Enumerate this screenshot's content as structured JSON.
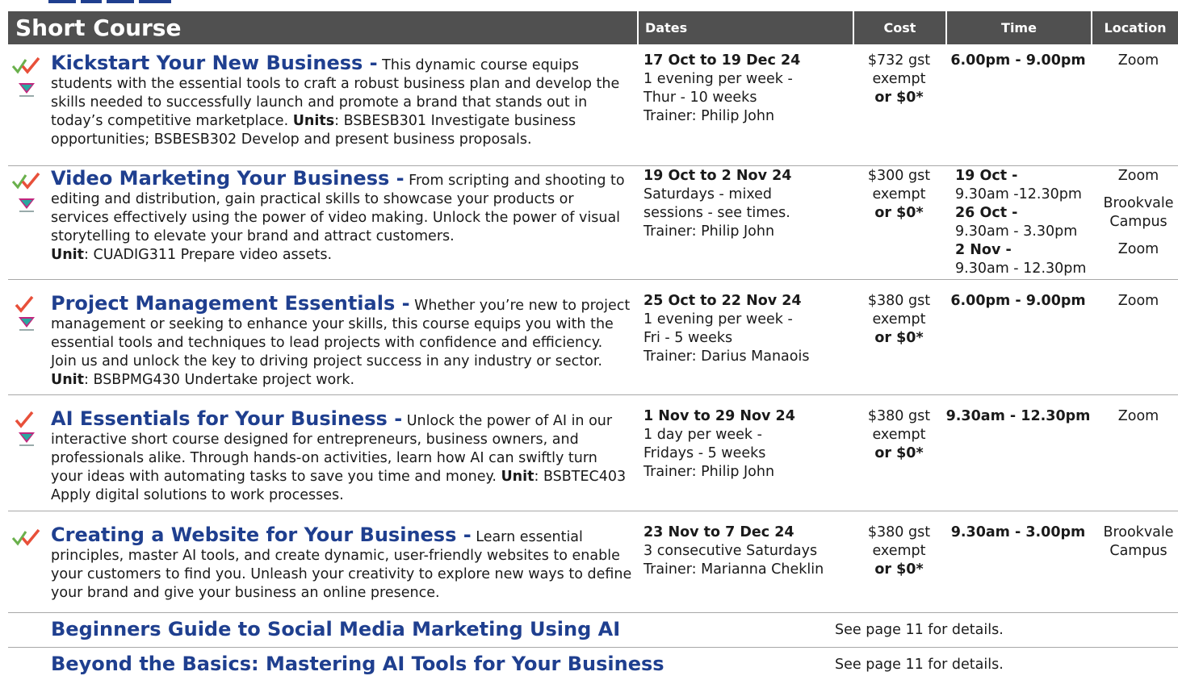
{
  "header": {
    "course": "Short Course",
    "dates": "Dates",
    "cost": "Cost",
    "time": "Time",
    "location": "Location"
  },
  "courses": [
    {
      "title": "Kickstart Your New Business -",
      "desc_a": " This dynamic course equips students with the essential tools to craft a robust business plan and develop the skills needed to successfully launch and promote a brand that stands out in today’s competitive marketplace. ",
      "units_label": "Units",
      "desc_b": ": BSBESB301 Investigate business opportunities; BSBESB302 Develop and present business proposals.",
      "date_range": "17 Oct to 19 Dec 24",
      "date_line1": "1 evening per week -",
      "date_line2": "Thur - 10 weeks",
      "trainer": "Trainer: Philip John",
      "cost_line1": "$732 gst",
      "cost_line2": "exempt",
      "cost_line3": "or $0*",
      "time": "6.00pm - 9.00pm",
      "location": "Zoom"
    },
    {
      "title": "Video Marketing Your Business -",
      "desc_a": " From scripting and shooting to editing and distribution, gain practical skills to showcase your products or services effectively using the power of video making. Unlock the power of visual storytelling to elevate your brand and attract customers.",
      "units_label": "Unit",
      "desc_b": ": CUADIG311 Prepare video assets.",
      "date_range": "19 Oct to 2 Nov 24",
      "date_line1": "Saturdays - mixed",
      "date_line2": "sessions - see times.",
      "trainer": "Trainer: Philip John",
      "cost_line1": "$300 gst",
      "cost_line2": "exempt",
      "cost_line3": "or $0*",
      "time1_label": "19 Oct -",
      "time1": "9.30am -12.30pm",
      "time2_label": "26 Oct -",
      "time2": "9.30am - 3.30pm",
      "time3_label": "2 Nov -",
      "time3": "9.30am - 12.30pm",
      "loc1": "Zoom",
      "loc2a": "Brookvale",
      "loc2b": "Campus",
      "loc3": "Zoom"
    },
    {
      "title": "Project Management Essentials -",
      "desc_a": " Whether you’re new to project management or seeking to enhance your skills, this course equips you with the essential tools and techniques to lead projects with confidence and efficiency. Join us and unlock the key to driving project success in any industry or sector. ",
      "units_label": "Unit",
      "desc_b": ": BSBPMG430 Undertake project work.",
      "date_range": "25 Oct to 22 Nov 24",
      "date_line1": "1 evening per week -",
      "date_line2": "Fri - 5 weeks",
      "trainer": "Trainer: Darius Manaois",
      "cost_line1": "$380 gst",
      "cost_line2": "exempt",
      "cost_line3": "or $0*",
      "time": "6.00pm - 9.00pm",
      "location": "Zoom"
    },
    {
      "title": "AI Essentials for Your Business -",
      "desc_a": " Unlock the power of AI in our interactive short course designed for entrepreneurs, business owners, and professionals alike. Through hands-on activities, learn how AI can swiftly turn your ideas with automating tasks to save you time and money. ",
      "units_label": "Unit",
      "desc_b": ": BSBTEC403 Apply digital solutions to work processes.",
      "date_range": "1 Nov to 29 Nov 24",
      "date_line1": "1 day per week -",
      "date_line2": "Fridays - 5 weeks",
      "trainer": "Trainer: Philip John",
      "cost_line1": "$380 gst",
      "cost_line2": "exempt",
      "cost_line3": "or $0*",
      "time": "9.30am - 12.30pm",
      "location": "Zoom"
    },
    {
      "title": "Creating a Website for Your Business -",
      "desc_a": " Learn essential principles, master AI tools, and create dynamic, user-friendly websites to enable your customers to find you. Unleash your creativity to explore new ways to define your brand and give your business an online presence.",
      "date_range": "23 Nov to 7 Dec 24",
      "date_line1": "3 consecutive Saturdays",
      "trainer": "Trainer: Marianna Cheklin",
      "cost_line1": "$380 gst",
      "cost_line2": "exempt",
      "cost_line3": "or $0*",
      "time": "9.30am - 3.00pm",
      "loc_a": "Brookvale",
      "loc_b": "Campus"
    }
  ],
  "extra": [
    {
      "title": "Beginners Guide to Social Media Marketing Using AI",
      "note": "See page 11 for details."
    },
    {
      "title": "Beyond the Basics: Mastering AI Tools for Your Business",
      "note": "See page 11 for details."
    }
  ],
  "colors": {
    "title_blue": "#1f3f8f",
    "header_grey": "#505050",
    "tick_green": "#6ab04c",
    "tick_red": "#e8503a",
    "logo_magenta": "#c2257e",
    "logo_teal": "#2aa7a0"
  },
  "icons": [
    "double-tick-icon",
    "single-tick-icon",
    "provider-logo-icon"
  ]
}
